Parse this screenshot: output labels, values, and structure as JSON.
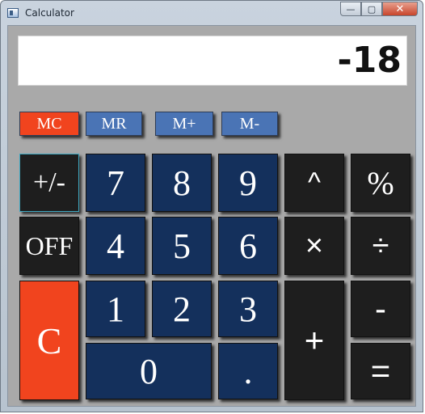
{
  "window": {
    "title": "Calculator",
    "minimize_label": "—",
    "maximize_label": "▢",
    "close_label": "✕"
  },
  "display": {
    "value": "-18"
  },
  "memory": {
    "mc": "MC",
    "mr": "MR",
    "mplus": "M+",
    "mminus": "M-"
  },
  "keys": {
    "sign": "+/-",
    "off": "OFF",
    "clear": "C",
    "d7": "7",
    "d8": "8",
    "d9": "9",
    "d4": "4",
    "d5": "5",
    "d6": "6",
    "d1": "1",
    "d2": "2",
    "d3": "3",
    "d0": "0",
    "dot": ".",
    "power": "^",
    "percent": "%",
    "multiply": "×",
    "divide": "÷",
    "plus": "+",
    "minus": "-",
    "equals": "="
  },
  "colors": {
    "accent_red": "#f1441e",
    "digit_blue": "#14305c",
    "memory_blue": "#4a74b5",
    "operator_dark": "#1e1e1e",
    "body_gray": "#a9a9a9"
  }
}
